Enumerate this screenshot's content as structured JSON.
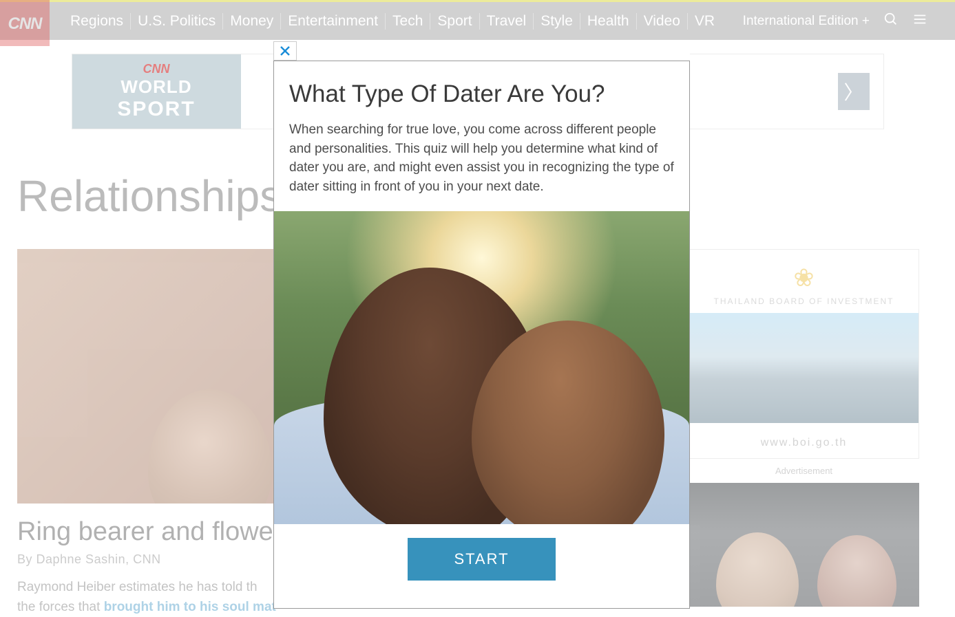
{
  "header": {
    "logo_text": "CNN",
    "nav": [
      "Regions",
      "U.S. Politics",
      "Money",
      "Entertainment",
      "Tech",
      "Sport",
      "Travel",
      "Style",
      "Health",
      "Video",
      "VR"
    ],
    "edition_label": "International Edition +"
  },
  "banner_ad": {
    "brand": "CNN",
    "line1": "WORLD",
    "line2": "SPORT"
  },
  "page": {
    "title": "Relationships"
  },
  "article": {
    "headline": "Ring bearer and flowe",
    "byline": "By Daphne Sashin, CNN",
    "body_before": "Raymond Heiber estimates he has told th",
    "body_line2": "the forces that ",
    "body_link": "brought him to his soul mat"
  },
  "sidebar": {
    "ad1": {
      "title": "THAILAND BOARD OF INVESTMENT",
      "link": "www.boi.go.th"
    },
    "advertisement_label": "Advertisement"
  },
  "modal": {
    "title": "What Type Of Dater Are You?",
    "description": "When searching for true love, you come across different people and personalities. This quiz will help you determine what kind of dater you are, and might even assist you in recognizing the type of dater sitting in front of you in your next date.",
    "start_label": "START"
  }
}
